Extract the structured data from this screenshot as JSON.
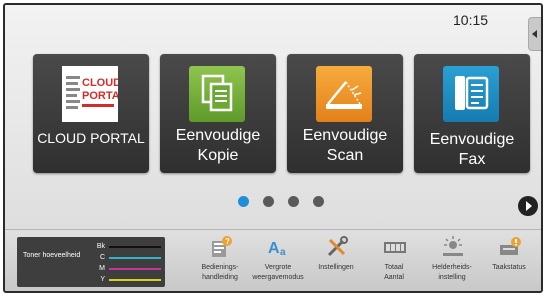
{
  "status_bar": {
    "time": "10:15"
  },
  "tiles": [
    {
      "label_lines": [
        "CLOUD PORTAL"
      ],
      "icon": "cloud-portal-logo-icon",
      "logo_text_1": "CLOUD",
      "logo_text_2": "PORTAL"
    },
    {
      "label_lines": [
        "Eenvoudige",
        "Kopie"
      ],
      "icon": "copy-icon"
    },
    {
      "label_lines": [
        "Eenvoudige",
        "Scan"
      ],
      "icon": "scan-icon"
    },
    {
      "label_lines": [
        "Eenvoudige",
        "Fax"
      ],
      "icon": "fax-icon"
    }
  ],
  "pagination": {
    "pages": 4,
    "current": 1
  },
  "colors": {
    "accent_blue": "#1e8fd6",
    "copy_green": "#6aaa34",
    "scan_orange": "#ee9428",
    "fax_blue": "#1e8ec4",
    "logo_red": "#d52b2b"
  },
  "toner": {
    "title": "Toner hoeveelheid",
    "rows": [
      {
        "label": "Bk",
        "color": "#111111",
        "level": 1.0
      },
      {
        "label": "C",
        "color": "#2fb6c9",
        "level": 1.0
      },
      {
        "label": "M",
        "color": "#c0399a",
        "level": 1.0
      },
      {
        "label": "Y",
        "color": "#d7d21c",
        "level": 1.0
      }
    ]
  },
  "bottom_bar": [
    {
      "label": "Bedienings-\nhandleiding",
      "icon": "manual-icon"
    },
    {
      "label": "Vergrote\nweergavemodus",
      "icon": "enlarged-display-icon"
    },
    {
      "label": "Instellingen",
      "icon": "settings-tools-icon"
    },
    {
      "label": "Totaal\nAantal",
      "icon": "total-count-icon"
    },
    {
      "label": "Helderheids-\ninstelling",
      "icon": "brightness-icon"
    },
    {
      "label": "Taakstatus",
      "icon": "job-status-icon"
    }
  ]
}
